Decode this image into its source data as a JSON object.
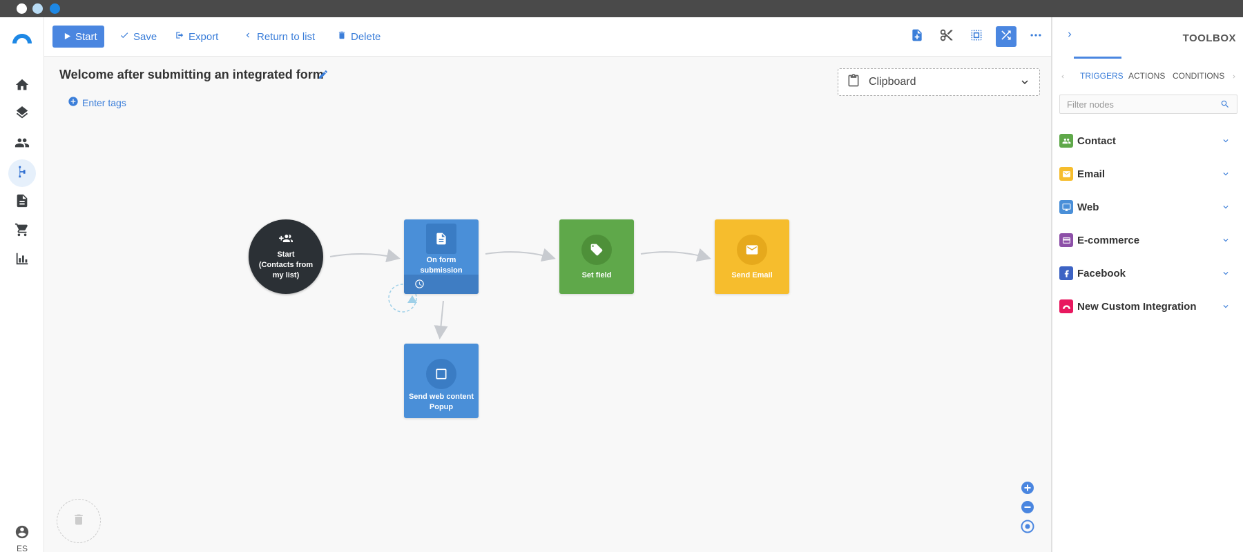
{
  "colors": {
    "accent": "#4a86e0",
    "contact": "#5fa84a",
    "email": "#f6bd2d",
    "web": "#4a8fd8",
    "ecommerce": "#8d50a8",
    "facebook": "#3d63c4",
    "custom": "#e8185f",
    "start_node": "#2b3035"
  },
  "nav": {
    "items": [
      {
        "icon": "home-icon"
      },
      {
        "icon": "layers-icon"
      },
      {
        "icon": "contacts-icon"
      },
      {
        "icon": "automation-icon",
        "active": true
      },
      {
        "icon": "document-icon"
      },
      {
        "icon": "cart-icon"
      },
      {
        "icon": "bar-chart-icon"
      }
    ],
    "language": "ES"
  },
  "toolbar": {
    "start_label": "Start",
    "save_label": "Save",
    "export_label": "Export",
    "return_label": "Return to list",
    "delete_label": "Delete"
  },
  "workflow": {
    "title": "Welcome after submitting an integrated form",
    "tags_label": "Enter tags",
    "clipboard_label": "Clipboard",
    "nodes": {
      "start_title": "Start",
      "start_subtitle": "(Contacts from my list)",
      "form": "On form submission",
      "set_field": "Set field",
      "send_email": "Send Email",
      "web_line1": "Send web content",
      "web_line2": "Popup"
    }
  },
  "toolbox": {
    "title": "TOOLBOX",
    "tabs": [
      "TRIGGERS",
      "ACTIONS",
      "CONDITIONS"
    ],
    "filter_placeholder": "Filter nodes",
    "categories": [
      {
        "label": "Contact",
        "icon": "contacts-icon"
      },
      {
        "label": "Email",
        "icon": "mail-icon"
      },
      {
        "label": "Web",
        "icon": "monitor-icon"
      },
      {
        "label": "E-commerce",
        "icon": "credit-card-icon"
      },
      {
        "label": "Facebook",
        "icon": "facebook-icon"
      },
      {
        "label": "New Custom Integration",
        "icon": "custom-integration-icon"
      }
    ]
  }
}
